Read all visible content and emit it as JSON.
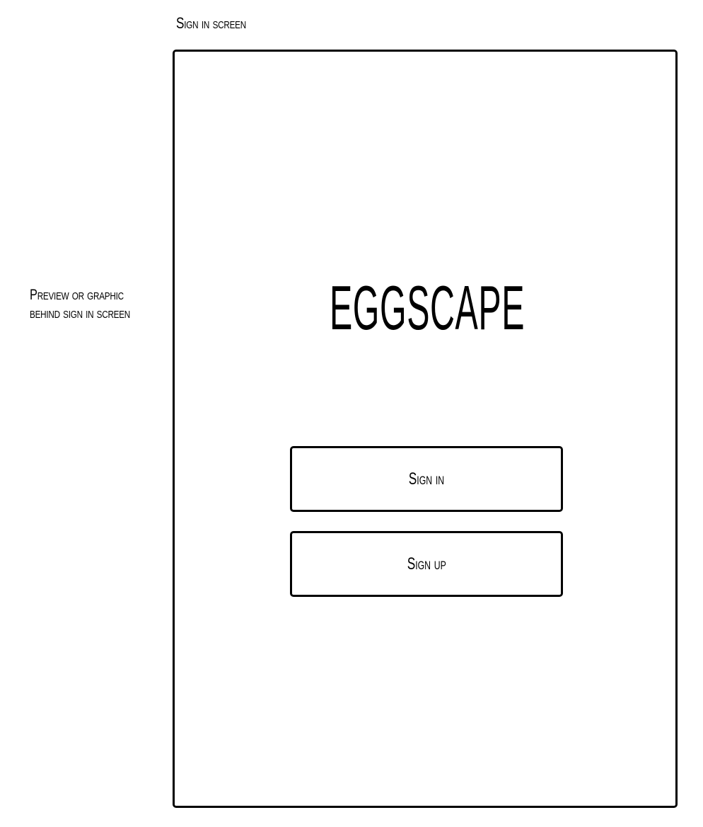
{
  "annotations": {
    "screen_label": "Sign in screen",
    "side_note_line1": "Preview or graphic",
    "side_note_line2": "behind sign in screen"
  },
  "screen": {
    "title": "EGGSCAPE",
    "sign_in_label": "Sign in",
    "sign_up_label": "Sign up"
  },
  "colors": {
    "stroke": "#000000",
    "background": "#ffffff"
  }
}
